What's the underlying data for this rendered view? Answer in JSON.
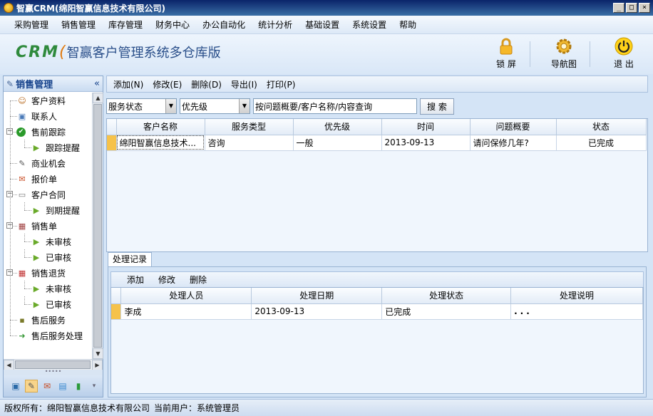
{
  "window": {
    "title": "智赢CRM(绵阳智赢信息技术有限公司)",
    "min": "_",
    "max": "□",
    "close": "×"
  },
  "menu": [
    "采购管理",
    "销售管理",
    "库存管理",
    "财务中心",
    "办公自动化",
    "统计分析",
    "基础设置",
    "系统设置",
    "帮助"
  ],
  "banner": {
    "logo_crm": "CRM",
    "logo_title": "智赢客户管理系统多仓库版",
    "lock_label": "锁 屏",
    "nav_label": "导航图",
    "exit_label": "退 出"
  },
  "sidebar": {
    "title": "销售管理",
    "collapse": "«",
    "items": [
      {
        "label": "客户资料",
        "level": 0,
        "icon": "person-icon"
      },
      {
        "label": "联系人",
        "level": 0,
        "icon": "contact-icon"
      },
      {
        "label": "售前跟踪",
        "level": 0,
        "icon": "check-icon",
        "expand": "−"
      },
      {
        "label": "跟踪提醒",
        "level": 1,
        "icon": "play-icon"
      },
      {
        "label": "商业机会",
        "level": 0,
        "icon": "pen-icon"
      },
      {
        "label": "报价单",
        "level": 0,
        "icon": "quote-icon"
      },
      {
        "label": "客户合同",
        "level": 0,
        "icon": "contract-icon",
        "expand": "−"
      },
      {
        "label": "到期提醒",
        "level": 1,
        "icon": "play-icon"
      },
      {
        "label": "销售单",
        "level": 0,
        "icon": "calendar-icon",
        "expand": "−"
      },
      {
        "label": "未审核",
        "level": 1,
        "icon": "play-icon"
      },
      {
        "label": "已审核",
        "level": 1,
        "icon": "play-icon"
      },
      {
        "label": "销售退货",
        "level": 0,
        "icon": "return-icon",
        "expand": "−"
      },
      {
        "label": "未审核",
        "level": 1,
        "icon": "play-icon"
      },
      {
        "label": "已审核",
        "level": 1,
        "icon": "play-icon"
      },
      {
        "label": "售后服务",
        "level": 0,
        "icon": "box-icon"
      },
      {
        "label": "售后服务处理",
        "level": 0,
        "icon": "arrow-icon"
      }
    ]
  },
  "toolbar": {
    "add": "添加(N)",
    "edit": "修改(E)",
    "delete": "删除(D)",
    "export": "导出(I)",
    "print": "打印(P)"
  },
  "filters": {
    "status": "服务状态",
    "priority": "优先级",
    "search_value": "按问题概要/客户名称/内容查询",
    "search_btn": "搜 索"
  },
  "service_table": {
    "columns": [
      "客户名称",
      "服务类型",
      "优先级",
      "时间",
      "问题概要",
      "状态"
    ],
    "rows": [
      [
        "绵阳智赢信息技术...",
        "咨询",
        "一般",
        "2013-09-13",
        "请问保修几年?",
        "已完成"
      ]
    ]
  },
  "records": {
    "tab": "处理记录",
    "add": "添加",
    "edit": "修改",
    "delete": "删除",
    "columns": [
      "处理人员",
      "处理日期",
      "处理状态",
      "处理说明"
    ],
    "rows": [
      [
        "李成",
        "2013-09-13",
        "已完成",
        "..."
      ]
    ]
  },
  "status": {
    "copyright": "版权所有：绵阳智赢信息技术有限公司",
    "user": "当前用户：系统管理员"
  }
}
